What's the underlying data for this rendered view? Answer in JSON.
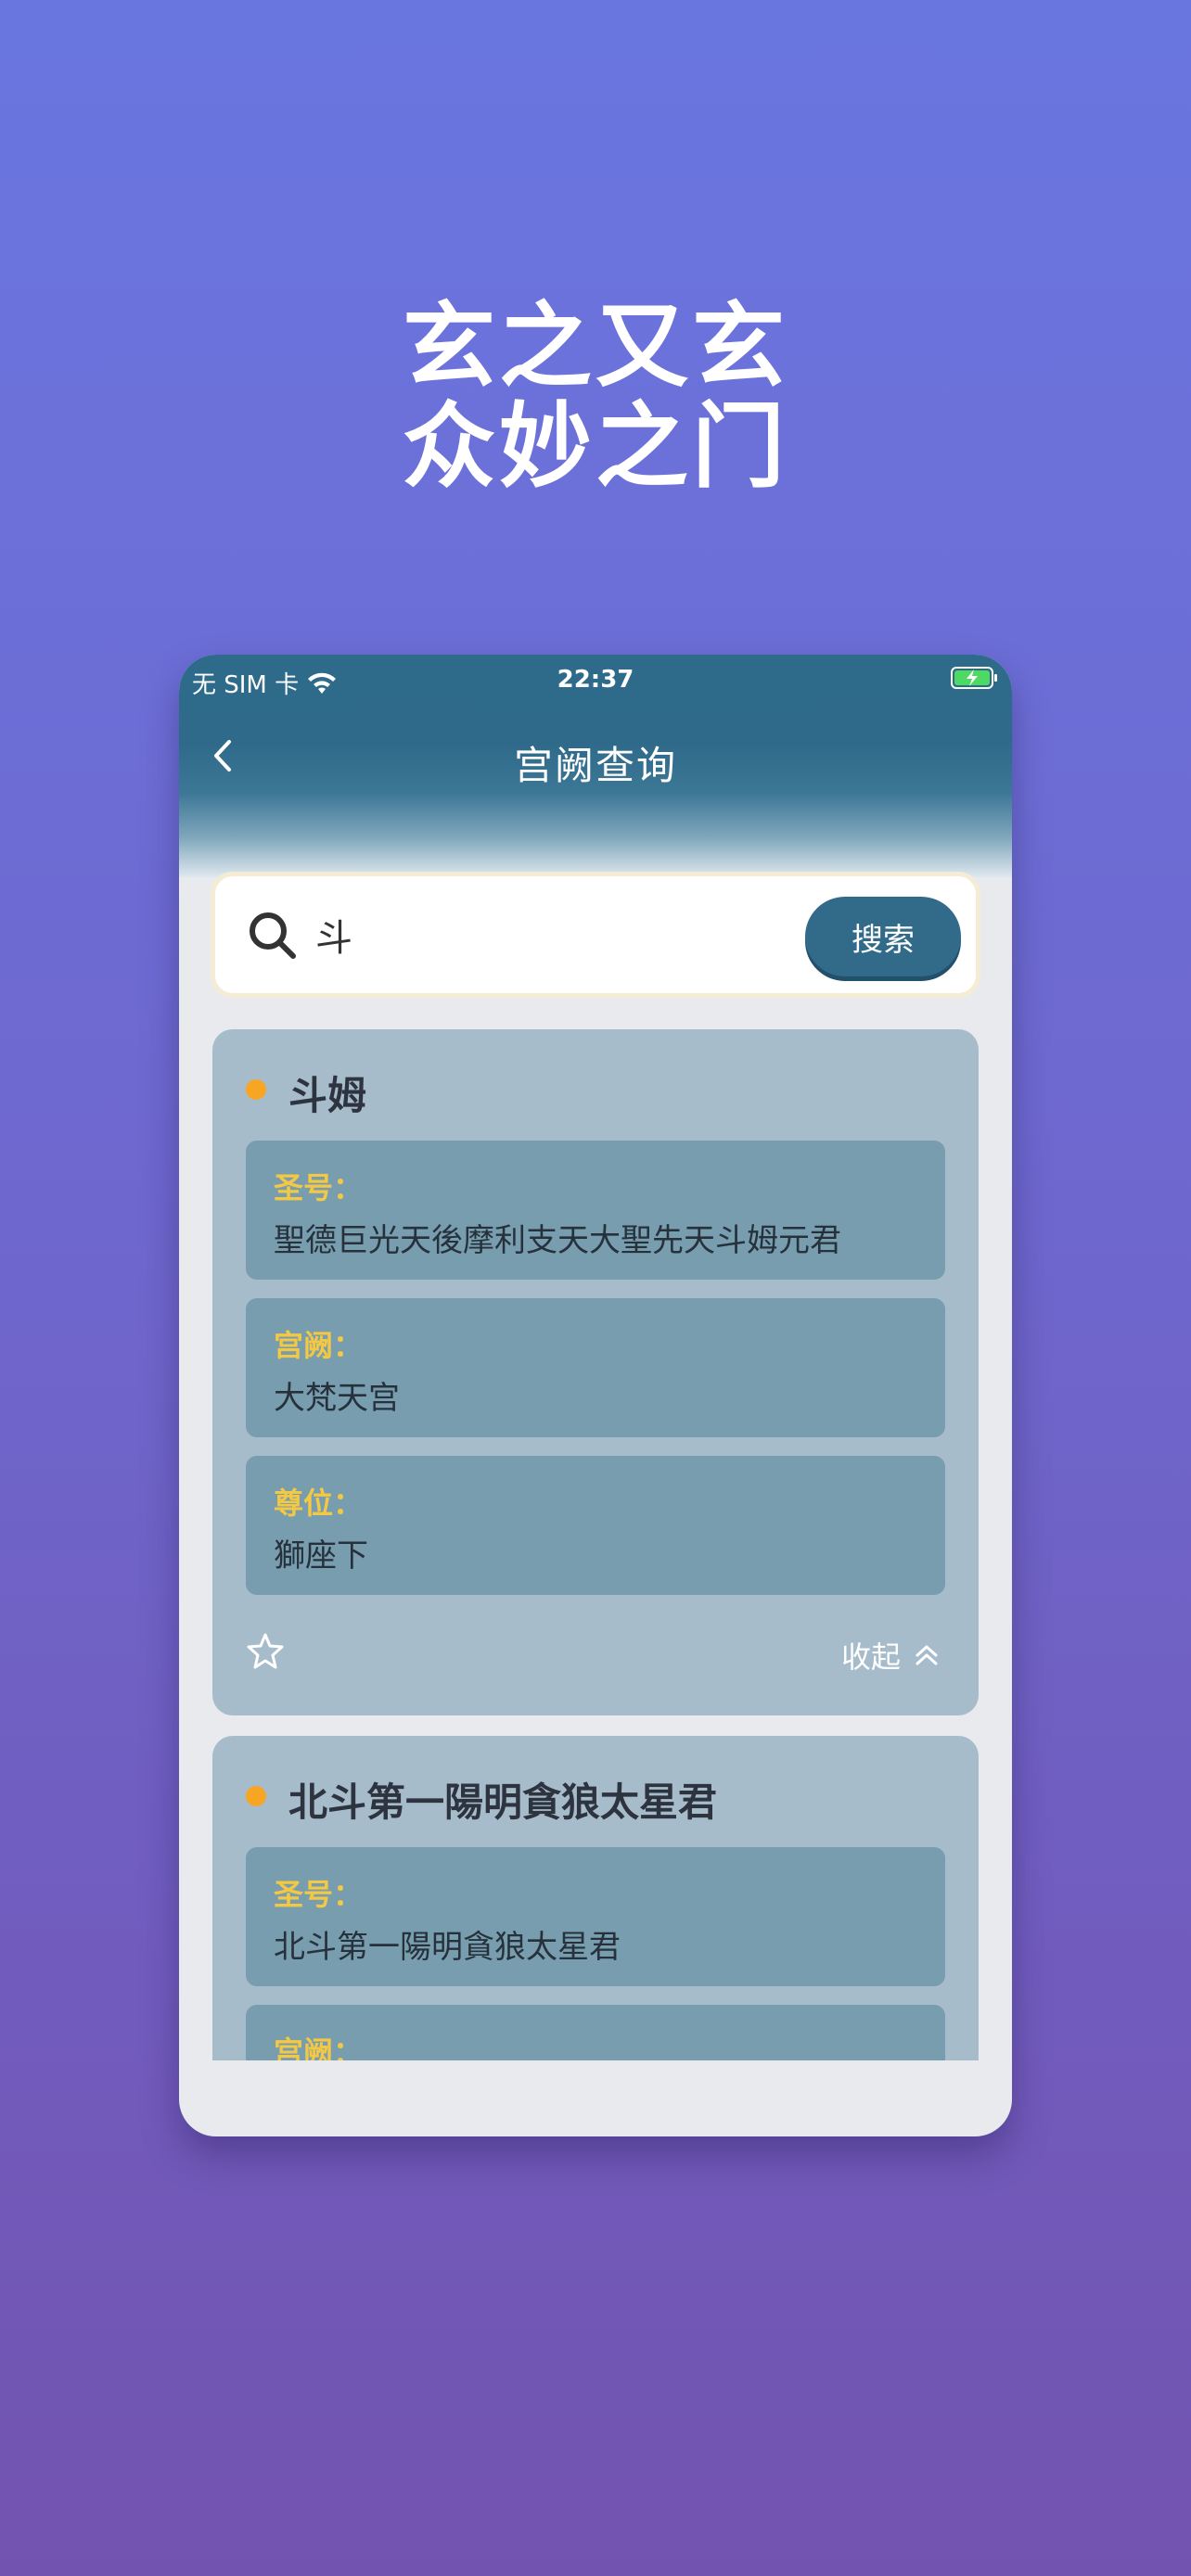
{
  "headline": {
    "line1": "玄之又玄",
    "line2": "众妙之门"
  },
  "status_bar": {
    "carrier": "无 SIM 卡",
    "time": "22:37"
  },
  "nav": {
    "title": "宫阙查询"
  },
  "search": {
    "value": "斗",
    "button_label": "搜索"
  },
  "results": [
    {
      "title": "斗姆",
      "fields": [
        {
          "label": "圣号：",
          "value": "聖德巨光天後摩利支天大聖先天斗姆元君"
        },
        {
          "label": "宫阙：",
          "value": "大梵天宫"
        },
        {
          "label": "尊位：",
          "value": "獅座下"
        }
      ],
      "collapse_label": "收起"
    },
    {
      "title": "北斗第一陽明貪狼太星君",
      "fields": [
        {
          "label": "圣号：",
          "value": "北斗第一陽明貪狼太星君"
        },
        {
          "label": "宫阙：",
          "value": ""
        }
      ]
    }
  ],
  "colors": {
    "accent": "#326a8a",
    "label": "#f2c845",
    "dot": "#f6a623",
    "card": "#a7bcca",
    "field": "#779dae"
  }
}
